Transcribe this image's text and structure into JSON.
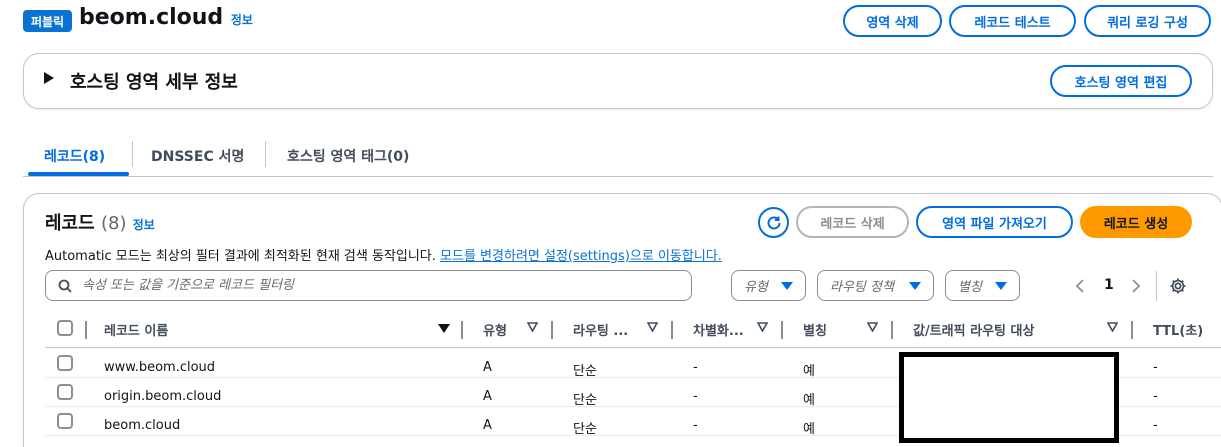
{
  "header": {
    "badge": "퍼블릭",
    "title": "beom.cloud",
    "info": "정보",
    "buttons": {
      "delete_zone": "영역 삭제",
      "test_record": "레코드 테스트",
      "query_logging": "쿼리 로깅 구성"
    }
  },
  "details": {
    "title": "호스팅 영역 세부 정보",
    "edit_button": "호스팅 영역 편집"
  },
  "tabs": [
    {
      "label": "레코드(8)",
      "active": true
    },
    {
      "label": "DNSSEC 서명",
      "active": false
    },
    {
      "label": "호스팅 영역 태그(0)",
      "active": false
    }
  ],
  "records": {
    "title": "레코드",
    "count": "(8)",
    "info": "정보",
    "description": "Automatic 모드는 최상의 필터 결과에 최적화된 현재 검색 동작입니다.",
    "description_link": "모드를 변경하려면 설정(settings)으로 이동합니다.",
    "buttons": {
      "delete": "레코드 삭제",
      "import": "영역 파일 가져오기",
      "create": "레코드 생성"
    },
    "search_placeholder": "속성 또는 값을 기준으로 레코드 필터링",
    "filters": [
      "유형",
      "라우팅 정책",
      "별칭"
    ],
    "page": "1",
    "columns": {
      "name": "레코드 이름",
      "type": "유형",
      "routing": "라우팅 ...",
      "differentiator": "차별화...",
      "alias": "별칭",
      "value": "값/트래픽 라우팅 대상",
      "ttl": "TTL(초)"
    },
    "rows": [
      {
        "name": "www.beom.cloud",
        "type": "A",
        "routing": "단순",
        "differentiator": "-",
        "alias": "예",
        "ttl": "-"
      },
      {
        "name": "origin.beom.cloud",
        "type": "A",
        "routing": "단순",
        "differentiator": "-",
        "alias": "예",
        "ttl": "-"
      },
      {
        "name": "beom.cloud",
        "type": "A",
        "routing": "단순",
        "differentiator": "-",
        "alias": "예",
        "ttl": "-"
      }
    ]
  },
  "colors": {
    "primary": "#006ce0",
    "accent_orange": "#ff9900",
    "badge_blue": "#0972d3"
  }
}
